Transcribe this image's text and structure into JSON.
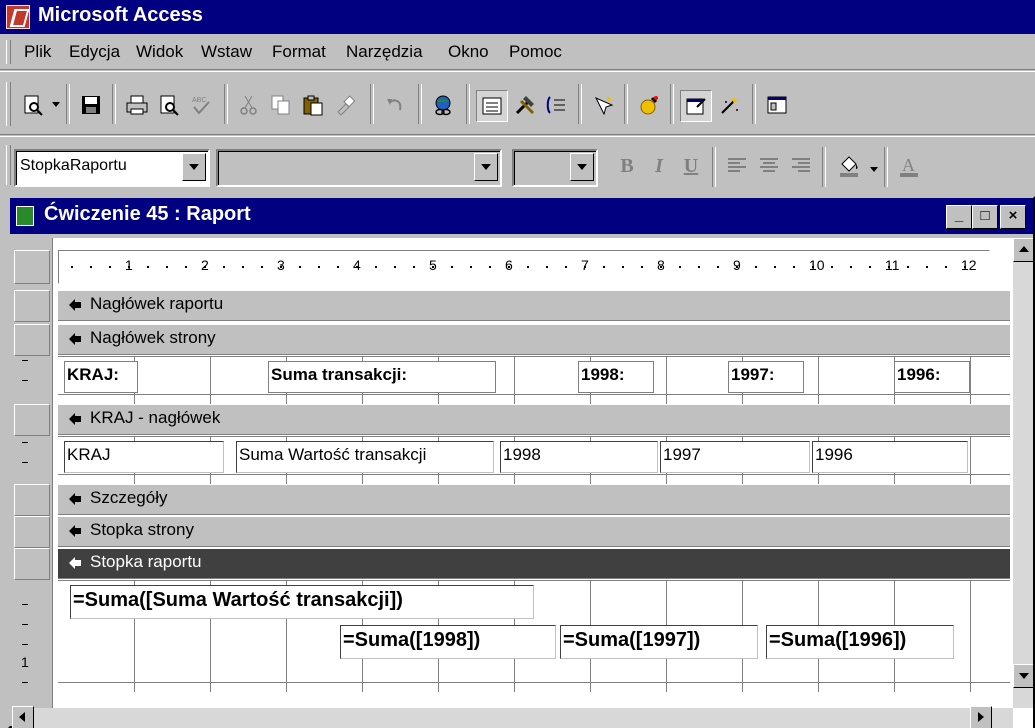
{
  "app": {
    "title": "Microsoft Access"
  },
  "menu": [
    "Plik",
    "Edycja",
    "Widok",
    "Wstaw",
    "Format",
    "Narzędzia",
    "Okno",
    "Pomoc"
  ],
  "toolbar": {
    "object_combo": "StopkaRaportu",
    "font_combo": "",
    "size_combo": "",
    "bold": "B",
    "italic": "I",
    "underline": "U"
  },
  "report_window": {
    "title": "Ćwiczenie 45 : Raport",
    "minimize": "_",
    "maximize": "□",
    "close": "×"
  },
  "ruler": [
    "1",
    "2",
    "3",
    "4",
    "5",
    "6",
    "7",
    "8",
    "9",
    "10",
    "11",
    "12"
  ],
  "bands": {
    "report_header": "Nagłówek raportu",
    "page_header": "Nagłówek strony",
    "group_header": "KRAJ - nagłówek",
    "detail": "Szczegóły",
    "page_footer": "Stopka strony",
    "report_footer": "Stopka raportu"
  },
  "page_header_controls": {
    "kraj": "KRAJ:",
    "suma": "Suma transakcji:",
    "y1998": "1998:",
    "y1997": "1997:",
    "y1996": "1996:"
  },
  "group_header_controls": {
    "kraj": "KRAJ",
    "suma": "Suma Wartość transakcji",
    "y1998": "1998",
    "y1997": "1997",
    "y1996": "1996"
  },
  "report_footer_controls": {
    "suma": "=Suma([Suma Wartość transakcji])",
    "s1998": "=Suma([1998])",
    "s1997": "=Suma([1997])",
    "s1996": "=Suma([1996])"
  },
  "left_ruler_mark": "1"
}
